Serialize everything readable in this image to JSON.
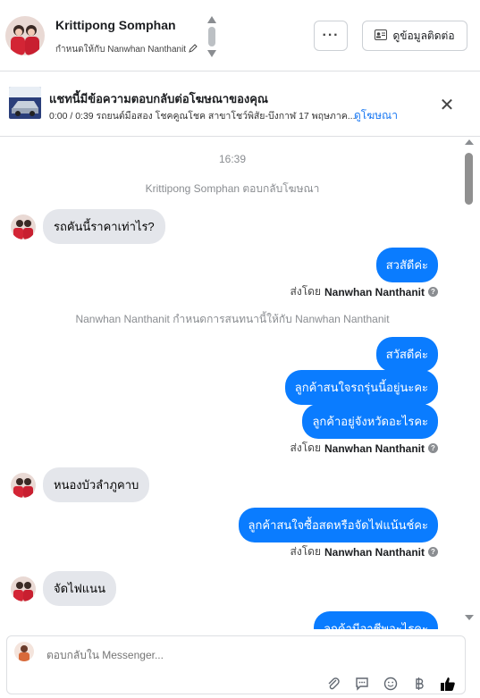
{
  "header": {
    "contact_name": "Krittipong Somphan",
    "assigned_text": "กำหนดให้กับ Nanwhan Nanthanit",
    "more_label": "···",
    "contact_info_label": "ดูข้อมูลติดต่อ"
  },
  "ad_banner": {
    "title": "แชทนี้มีข้อความตอบกลับต่อโฆษณาของคุณ",
    "meta": "0:00 / 0:39 รถยนต์มือสอง โชคคูณโชค สาขาโชว์พิสัย-บึงกาฬ 17 พฤษภาค...",
    "view_ad_label": "ดูโฆษณา",
    "close_label": "✕"
  },
  "conversation": {
    "timestamp": "16:39",
    "system_reply_ad": "Krittipong Somphan ตอบกลับโฆษณา",
    "msg_in_1": "รถคันนี้ราคาเท่าไร?",
    "msg_out_1": "สวสัดีค่ะ",
    "sent_by_prefix_1": "ส่งโดย",
    "sent_by_name_1": "Nanwhan Nanthanit",
    "system_assign": "Nanwhan Nanthanit กำหนดการสนทนานี้ให้กับ Nanwhan Nanthanit",
    "msg_out_2": "สวัสดีค่ะ",
    "msg_out_3": "ลูกค้าสนใจรถรุ่นนี้อยู่นะคะ",
    "msg_out_4": "ลูกค้าอยู่จังหวัดอะไรคะ",
    "sent_by_prefix_2": "ส่งโดย",
    "sent_by_name_2": "Nanwhan Nanthanit",
    "msg_in_2": "หนองบัวลำภูคาบ",
    "msg_out_5": "ลูกค้าสนใจซื้อสดหรือจัดไฟแน้นช์คะ",
    "sent_by_prefix_3": "ส่งโดย",
    "sent_by_name_3": "Nanwhan Nanthanit",
    "msg_in_3": "จัดไฟแนน",
    "msg_out_6_partial": "ลูกค้ามีอาชีพอะไรคะ"
  },
  "composer": {
    "placeholder": "ตอบกลับใน Messenger..."
  },
  "colors": {
    "outgoing_bubble": "#0a7cff",
    "incoming_bubble": "#e4e6eb",
    "link": "#1877f2"
  }
}
